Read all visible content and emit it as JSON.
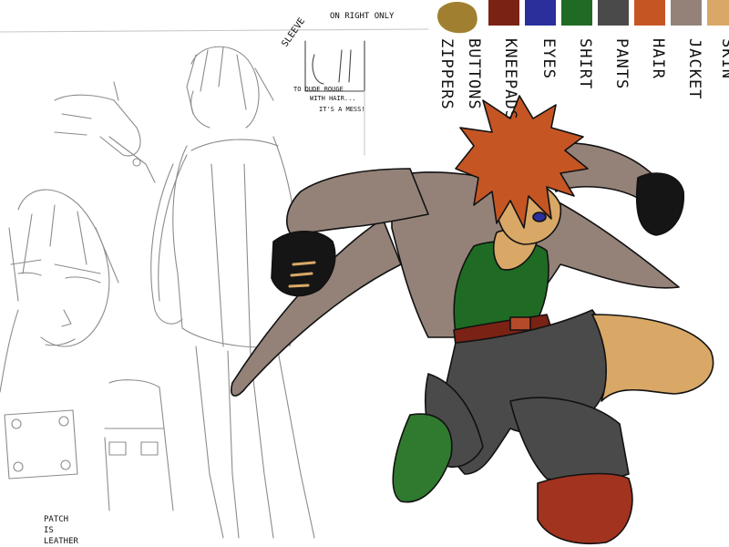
{
  "palette": {
    "swatches": [
      {
        "label": "ZIPPERS",
        "color": "#a08030",
        "shape": "blob"
      },
      {
        "label": "BUTTONS",
        "color": "#a08030",
        "shape": "none"
      },
      {
        "label": "KNEEPADS",
        "color": "#7a2214",
        "shape": "rect"
      },
      {
        "label": "EYES",
        "color": "#2a2f9c",
        "shape": "rect"
      },
      {
        "label": "SHIRT",
        "color": "#1f6b24",
        "shape": "rect"
      },
      {
        "label": "PANTS",
        "color": "#4a4a4a",
        "shape": "rect"
      },
      {
        "label": "HAIR",
        "color": "#c55624",
        "shape": "rect"
      },
      {
        "label": "JACKET",
        "color": "#948279",
        "shape": "rect"
      },
      {
        "label": "SKIN",
        "color": "#d9a866",
        "shape": "rect"
      }
    ]
  },
  "notes": {
    "sleeve_title": "SLEEVE",
    "right_only": "ON RIGHT ONLY",
    "hair_note_1": "TO DUDE ROUGE",
    "hair_note_2": "WITH HAIR...",
    "hair_note_3": "IT'S A MESS!",
    "patch_note_1": "PATCH",
    "patch_note_2": "IS",
    "patch_note_3": "LEATHER"
  },
  "colors": {
    "sketch_line": "#8c8c8c",
    "ink": "#111111",
    "skin": "#d9a866",
    "hair": "#c55624",
    "jacket": "#948279",
    "shirt": "#1f6b24",
    "pants": "#4a4a4a",
    "kneepad": "#a2331f",
    "belt": "#7a2214",
    "eyes": "#2a2f9c",
    "shoe": "#2f7a2f",
    "glove": "#151515"
  }
}
